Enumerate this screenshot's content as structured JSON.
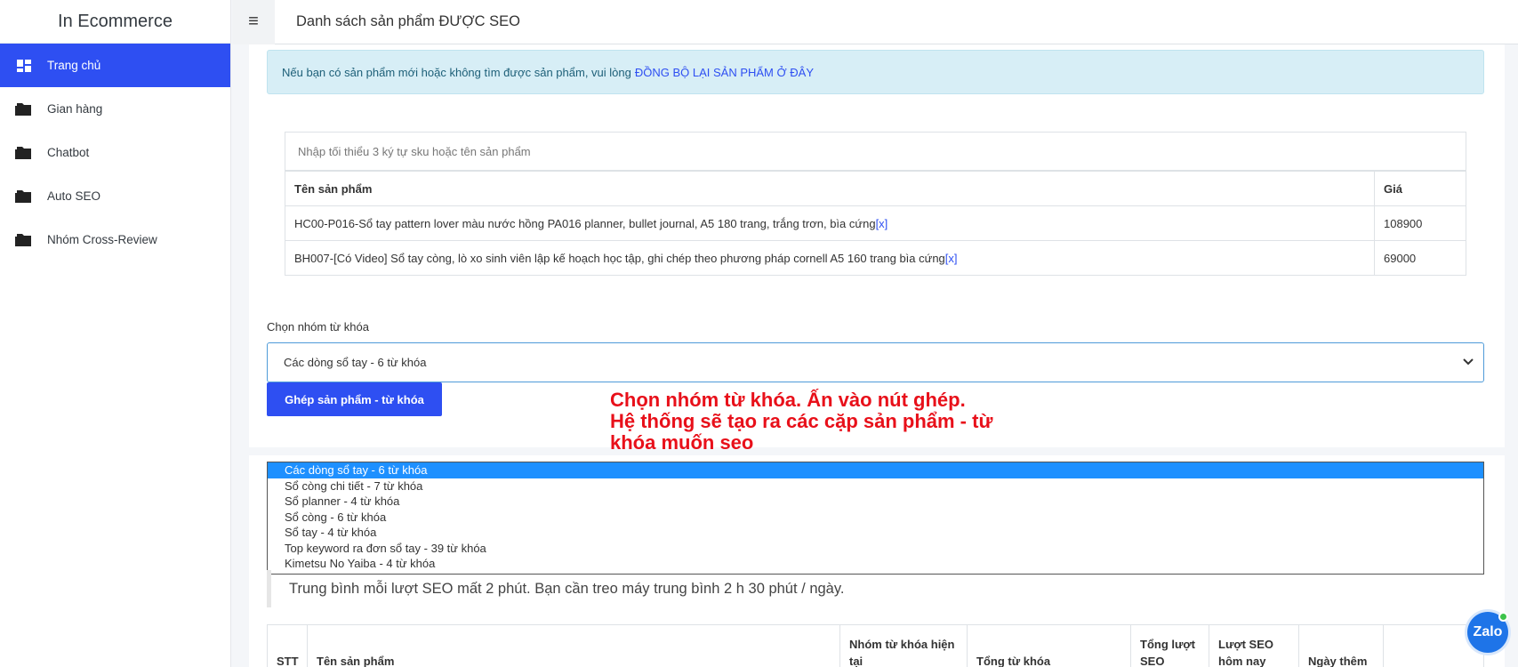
{
  "brand": "In Ecommerce",
  "sidebar": {
    "items": [
      {
        "label": "Trang chủ",
        "icon": "dashboard-icon",
        "active": true
      },
      {
        "label": "Gian hàng",
        "icon": "folder-icon"
      },
      {
        "label": "Chatbot",
        "icon": "folder-icon"
      },
      {
        "label": "Auto SEO",
        "icon": "folder-icon"
      },
      {
        "label": "Nhóm Cross-Review",
        "icon": "folder-icon"
      }
    ]
  },
  "header": {
    "menu_icon": "hamburger-icon",
    "title": "Danh sách sản phẩm ĐƯỢC SEO"
  },
  "alert": {
    "text": "Nếu bạn có sản phẩm mới hoặc không tìm được sản phẩm, vui lòng",
    "link": "ĐỒNG BỘ LẠI SẢN PHẨM Ở ĐÂY"
  },
  "product_search": {
    "placeholder": "Nhập tối thiểu 3 ký tự sku hoặc tên sản phẩm"
  },
  "product_table": {
    "columns": [
      "Tên sản phẩm",
      "Giá"
    ],
    "rows": [
      {
        "name": "HC00-P016-Sổ tay pattern lover màu nước hồng PA016 planner, bullet journal, A5 180 trang, trắng trơn, bìa cứng",
        "remove": "[x]",
        "price": "108900"
      },
      {
        "name": "BH007-[Có Video] Sổ tay còng, lò xo sinh viên lập kế hoạch học tập, ghi chép theo phương pháp cornell A5 160 trang bìa cứng",
        "remove": "[x]",
        "price": "69000"
      }
    ]
  },
  "keyword_group": {
    "label": "Chọn nhóm từ khóa",
    "selected": "Các dòng sổ tay - 6 từ khóa",
    "options": [
      "Các dòng sổ tay - 6 từ khóa",
      "Sổ còng chi tiết - 7 từ khóa",
      "Sổ planner - 4 từ khóa",
      "Sổ còng - 6 từ khóa",
      "Sổ tay - 4 từ khóa",
      "Top keyword ra đơn sổ tay - 39 từ khóa",
      "Kimetsu No Yaiba - 4 từ khóa"
    ]
  },
  "match_button": "Ghép sản phẩm - từ khóa",
  "annotation": {
    "line1": "Chọn nhóm từ khóa. Ấn vào nút ghép.",
    "line2": "Hệ thống sẽ tạo ra các cặp sản phẩm - từ",
    "line3": "khóa muốn seo"
  },
  "info": "Trung bình mỗi lượt SEO mất 2 phút. Bạn cần treo máy trung bình 2 h 30 phút / ngày.",
  "list_table": {
    "columns": [
      "STT",
      "Tên sản phẩm",
      "Nhóm từ khóa hiện tại",
      "Tổng từ khóa",
      "Tổng lượt SEO",
      "Lượt SEO hôm nay",
      "Ngày thêm",
      ""
    ]
  },
  "zalo_label": "Zalo",
  "colors": {
    "accent": "#2e4ff2",
    "alert_bg": "#d7eef6",
    "annotation": "#e8101a",
    "selected_option": "#1e90ff"
  }
}
